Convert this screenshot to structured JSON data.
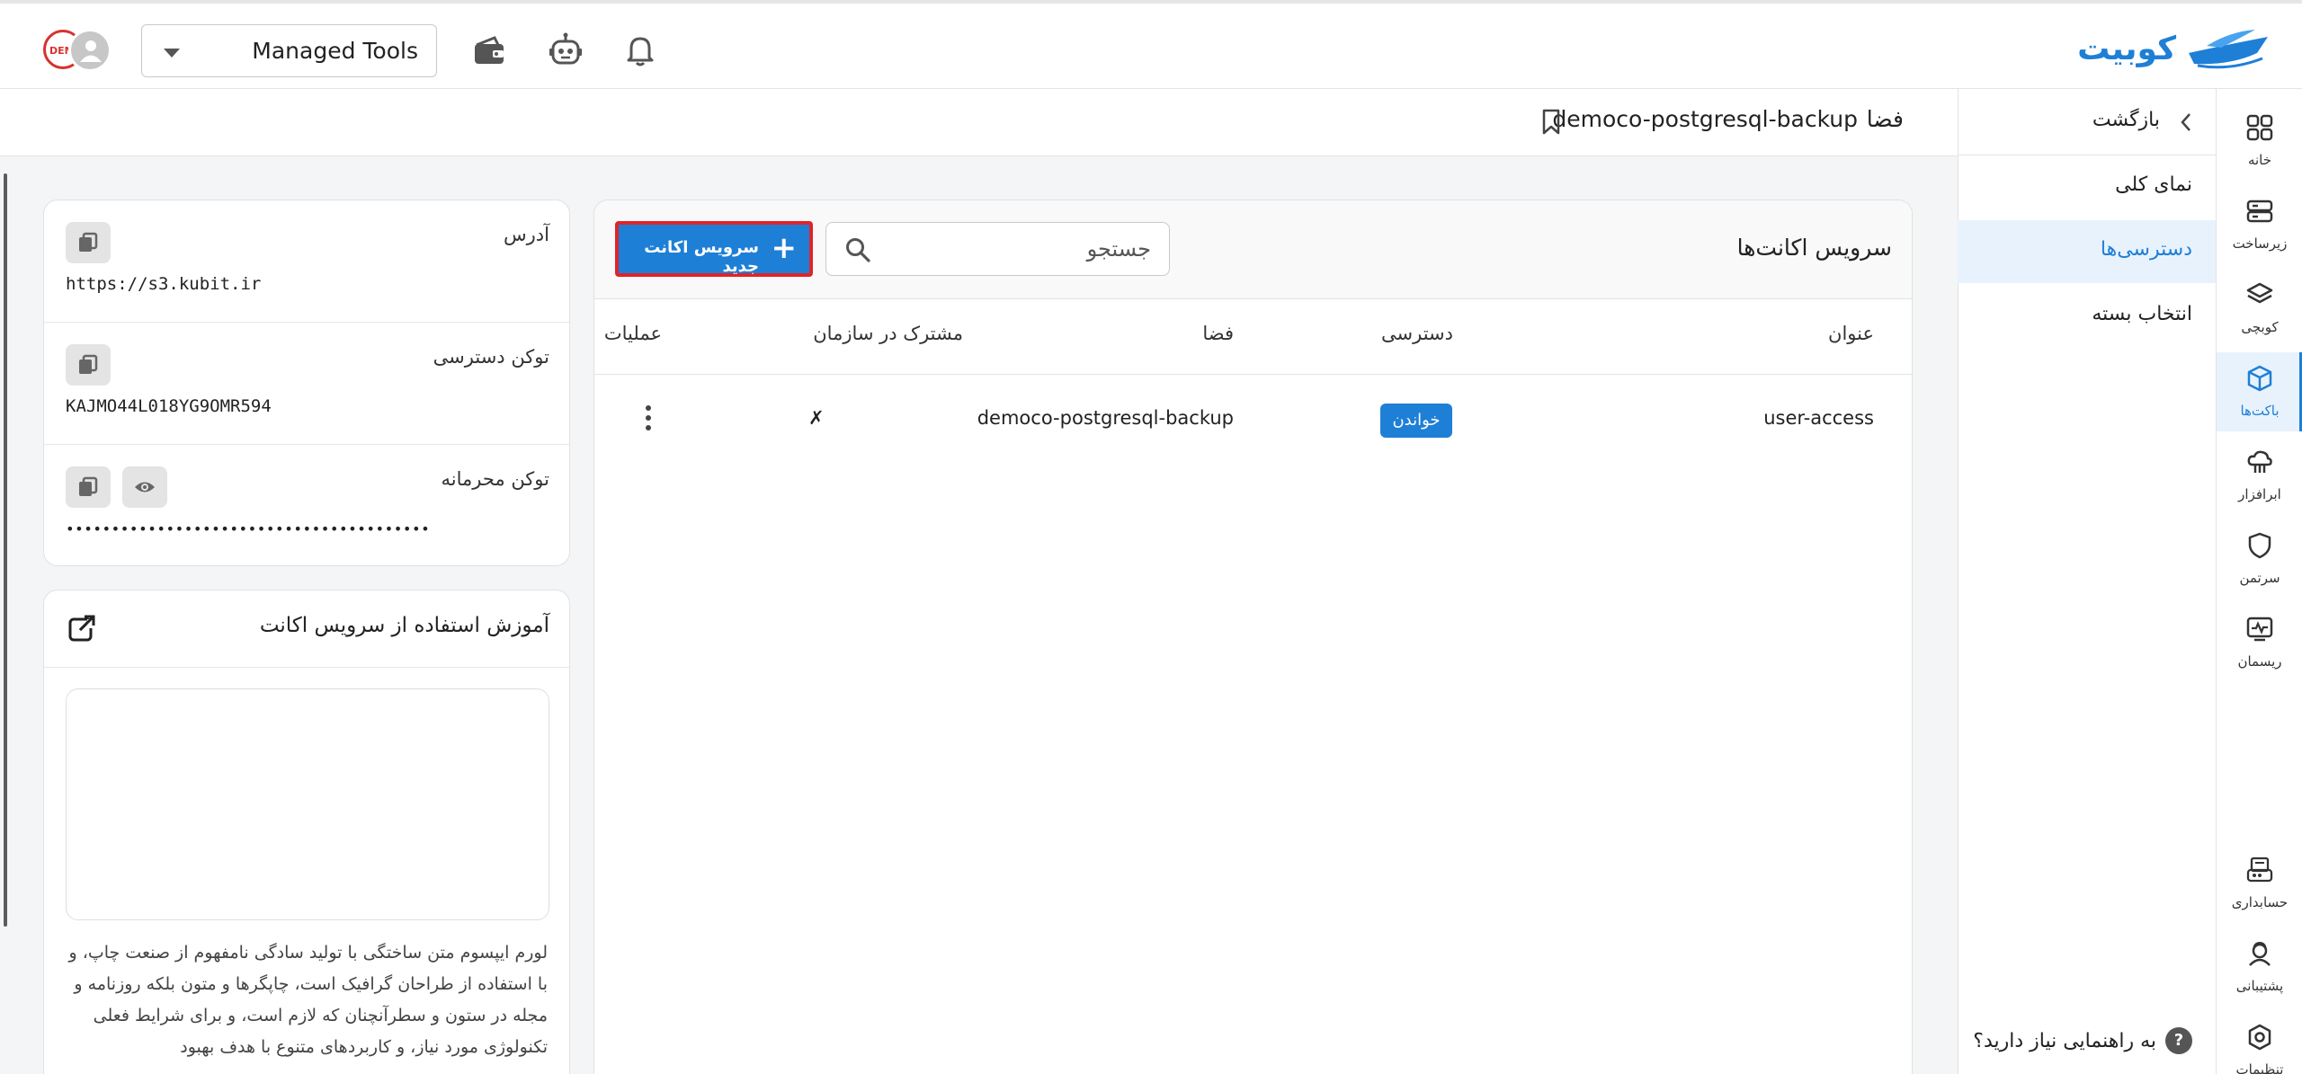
{
  "header": {
    "brand": "کوبیت",
    "tools_select_value": "Managed Tools",
    "avatar_badge": "DEM",
    "icons": [
      "wallet-icon",
      "robot-icon",
      "bell-icon"
    ]
  },
  "rail": {
    "items": [
      {
        "label": "خانه",
        "icon": "grid-icon"
      },
      {
        "label": "زیرساخت",
        "icon": "server-icon"
      },
      {
        "label": "کوبچی",
        "icon": "layers-icon"
      },
      {
        "label": "باکت‌ها",
        "icon": "cube-icon"
      },
      {
        "label": "ابرافزار",
        "icon": "cloud-icon"
      },
      {
        "label": "سرتمن",
        "icon": "shield-icon"
      },
      {
        "label": "ریسمان",
        "icon": "monitor-icon"
      },
      {
        "label": "حسابداری",
        "icon": "receipt-icon"
      },
      {
        "label": "پشتیبانی",
        "icon": "headset-icon"
      },
      {
        "label": "تنظیمات",
        "icon": "settings-icon"
      }
    ],
    "active_index": 3
  },
  "submenu": {
    "back": "بازگشت",
    "items": [
      "نمای کلی",
      "دسترسی‌ها",
      "انتخاب بسته"
    ],
    "active_index": 1,
    "help": "به راهنمایی نیاز دارید؟",
    "help_glyph": "?"
  },
  "breadcrumb": {
    "space_word": "فضا",
    "space_name": "democo-postgresql-backup"
  },
  "credentials": {
    "address_label": "آدرس",
    "address_value": "https://s3.kubit.ir",
    "access_label": "توکن دسترسی",
    "access_value": "KAJMO44L018YG9OMR594",
    "secret_label": "توکن محرمانه",
    "secret_value": "••••••••••••••••••••••••••••••••••••••••"
  },
  "tutorial": {
    "title": "آموزش استفاده از سرویس اکانت",
    "text": "لورم ایپسوم متن ساختگی با تولید سادگی نامفهوم از صنعت چاپ، و با استفاده از طراحان گرافیک است، چاپگرها و متون بلکه روزنامه و مجله در ستون و سطرآنچنان که لازم است، و برای شرایط فعلی تکنولوژی مورد نیاز، و کاربردهای متنوع با هدف بهبود"
  },
  "service_accounts": {
    "title": "سرویس اکانت‌ها",
    "search_placeholder": "جستجو",
    "new_button": "سرویس اکانت جدید",
    "new_button_plus": "+",
    "columns": {
      "title": "عنوان",
      "access": "دسترسی",
      "space": "فضا",
      "shared": "مشترک در سازمان",
      "actions": "عملیات"
    },
    "rows": [
      {
        "title": "user-access",
        "access": "خواندن",
        "space": "democo-postgresql-backup",
        "shared": "✗"
      }
    ]
  },
  "colors": {
    "accent": "#1e7fd6",
    "highlight_border": "#e0232a"
  }
}
